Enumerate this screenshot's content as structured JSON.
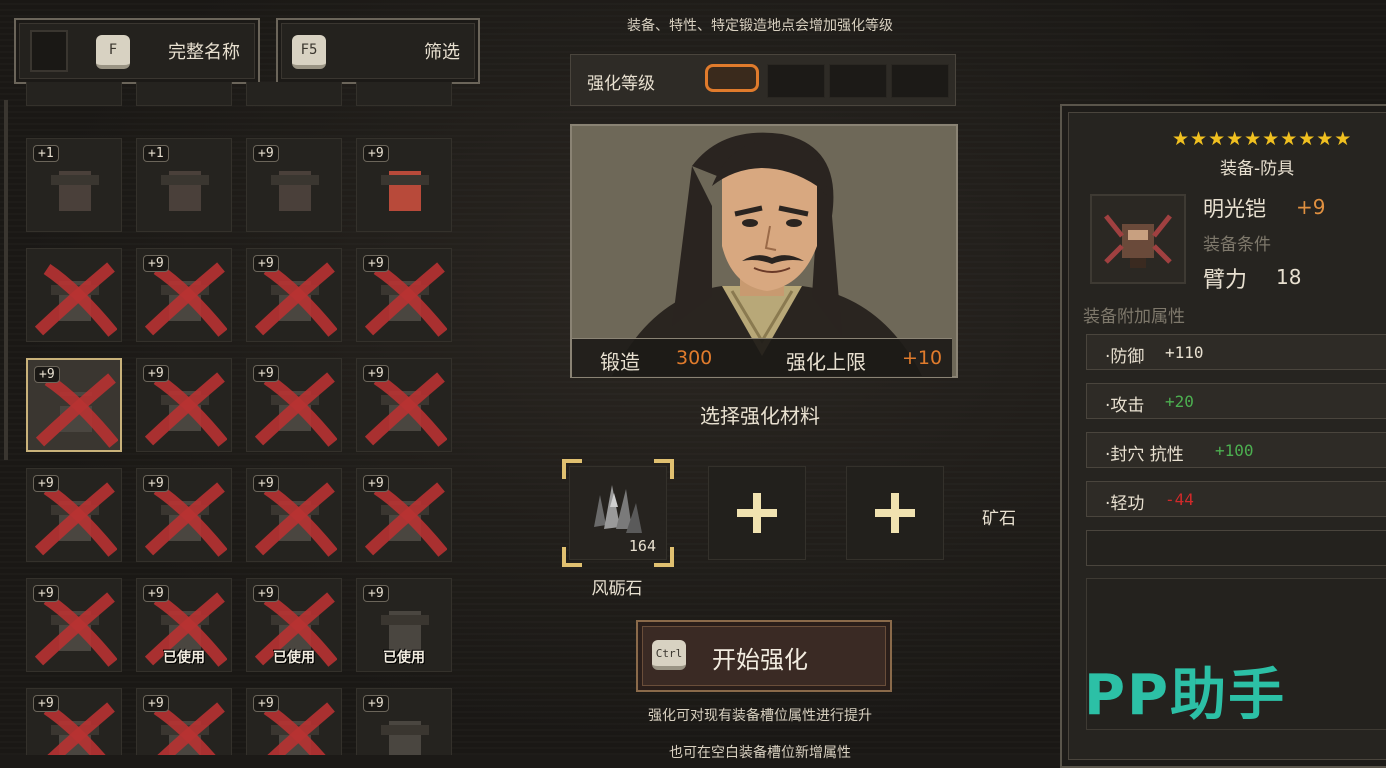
{
  "top_bar": {
    "name_key": "F",
    "name_label": "完整名称",
    "filter_key": "F5",
    "filter_label": "筛选"
  },
  "inventory": {
    "rows": [
      [
        {
          "level": "+1",
          "used": "",
          "crossed": false
        },
        {
          "level": "+1",
          "used": "",
          "crossed": false
        },
        {
          "level": "+9",
          "used": "",
          "crossed": false
        },
        {
          "level": "+9",
          "used": "",
          "crossed": false
        }
      ],
      [
        {
          "level": "",
          "used": "",
          "crossed": true
        },
        {
          "level": "+9",
          "used": "",
          "crossed": true
        },
        {
          "level": "+9",
          "used": "",
          "crossed": true
        },
        {
          "level": "+9",
          "used": "",
          "crossed": true
        }
      ],
      [
        {
          "level": "+9",
          "used": "",
          "crossed": true,
          "selected": true
        },
        {
          "level": "+9",
          "used": "",
          "crossed": true
        },
        {
          "level": "+9",
          "used": "",
          "crossed": true
        },
        {
          "level": "+9",
          "used": "",
          "crossed": true
        }
      ],
      [
        {
          "level": "+9",
          "used": "",
          "crossed": true
        },
        {
          "level": "+9",
          "used": "",
          "crossed": true
        },
        {
          "level": "+9",
          "used": "",
          "crossed": true
        },
        {
          "level": "+9",
          "used": "",
          "crossed": true
        }
      ],
      [
        {
          "level": "+9",
          "used": "",
          "crossed": true
        },
        {
          "level": "+9",
          "used": "已使用",
          "crossed": true
        },
        {
          "level": "+9",
          "used": "已使用",
          "crossed": true
        },
        {
          "level": "+9",
          "used": "已使用",
          "crossed": false
        }
      ],
      [
        {
          "level": "+9",
          "used": "",
          "crossed": true
        },
        {
          "level": "+9",
          "used": "",
          "crossed": true
        },
        {
          "level": "+9",
          "used": "",
          "crossed": true
        },
        {
          "level": "+9",
          "used": "",
          "crossed": false
        }
      ]
    ]
  },
  "forge": {
    "hint_top": "装备、特性、特定锻造地点会增加强化等级",
    "enh_level_label": "强化等级",
    "enh_level_filled": 1,
    "enh_level_total": 4,
    "forge_label": "锻造",
    "forge_value": "300",
    "limit_label": "强化上限",
    "limit_value": "+10",
    "choose_material": "选择强化材料",
    "material_count": "164",
    "material_name": "风砺石",
    "ore_label": "矿石",
    "start_key": "Ctrl",
    "start_label": "开始强化",
    "hint_bottom_1": "强化可对现有装备槽位属性进行提升",
    "hint_bottom_2": "也可在空白装备槽位新增属性"
  },
  "item": {
    "stars": "★★★★★★★★★★",
    "category": "装备-防具",
    "name": "明光铠",
    "plus": "+9",
    "requirement_label": "装备条件",
    "strength_label": "臂力",
    "strength_value": "18",
    "extra_label": "装备附加属性",
    "attributes": [
      {
        "name": "·防御",
        "value": "+110",
        "color": "#e8e0d0"
      },
      {
        "name": "·攻击",
        "value": "+20",
        "color": "#4caf50"
      },
      {
        "name": "·封穴 抗性",
        "value": "+100",
        "color": "#4caf50"
      },
      {
        "name": "·轻功",
        "value": "-44",
        "color": "#d02a2a"
      }
    ]
  },
  "watermark": "PP助手",
  "colors": {
    "accent_orange": "#e07b2c",
    "cross_red": "#b83232",
    "star_gold": "#f0c020"
  }
}
